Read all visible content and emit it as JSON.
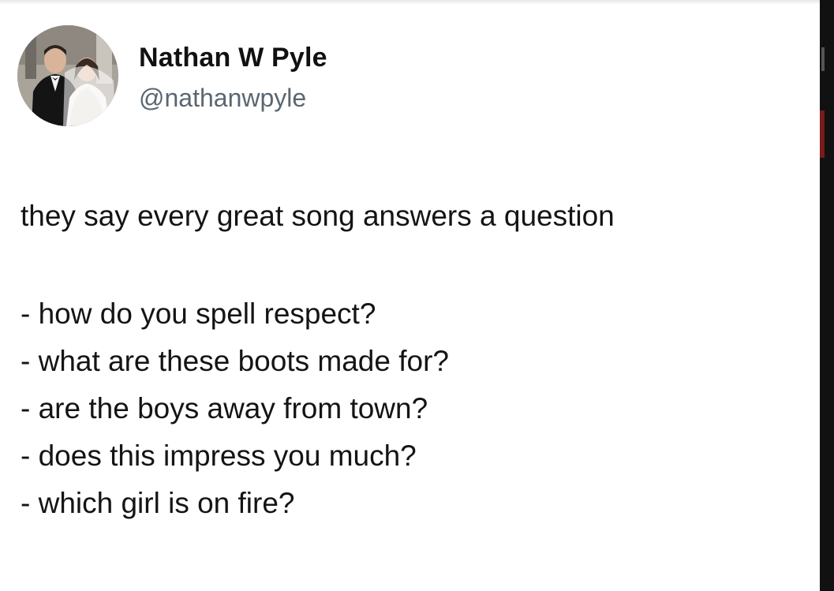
{
  "author": {
    "display_name": "Nathan W Pyle",
    "handle": "@nathanwpyle",
    "avatar_icon": "wedding-photo-avatar"
  },
  "tweet": {
    "intro": "they say every great song answers a question",
    "questions": [
      "- how do you spell respect?",
      "- what are these boots made for?",
      "- are the boys away from town?",
      "- does this impress you much?",
      "- which girl is on fire?"
    ]
  },
  "colors": {
    "text": "#141414",
    "handle": "#5b6670",
    "background": "#ffffff"
  }
}
